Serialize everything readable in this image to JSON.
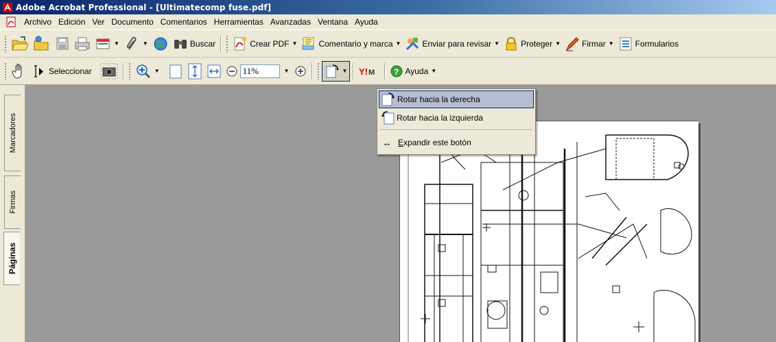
{
  "window": {
    "title": "Adobe Acrobat Professional - [Ultimatecomp fuse.pdf]"
  },
  "menubar": {
    "items": [
      "Archivo",
      "Edición",
      "Ver",
      "Documento",
      "Comentarios",
      "Herramientas",
      "Avanzadas",
      "Ventana",
      "Ayuda"
    ]
  },
  "toolbar1": {
    "search_label": "Buscar",
    "create_pdf_label": "Crear PDF",
    "comment_label": "Comentario y marca",
    "review_label": "Enviar para revisar",
    "protect_label": "Proteger",
    "sign_label": "Firmar",
    "forms_label": "Formularios"
  },
  "toolbar2": {
    "select_label": "Seleccionar",
    "zoom_value": "11%",
    "help_label": "Ayuda"
  },
  "navpanel": {
    "tabs": [
      "Marcadores",
      "Firmas",
      "Páginas"
    ],
    "active_tab": "Páginas"
  },
  "dropdown": {
    "items": [
      "Rotar hacia la derecha",
      "Rotar hacia la izquierda"
    ],
    "expand_prefix": "E",
    "expand_rest": "xpandir este botón",
    "highlighted": "Rotar hacia la derecha"
  },
  "colors": {
    "titlebar": "#0a246a",
    "chrome": "#ece9d8",
    "highlight": "#b6bdd2",
    "docarea": "#9a9a9a"
  }
}
